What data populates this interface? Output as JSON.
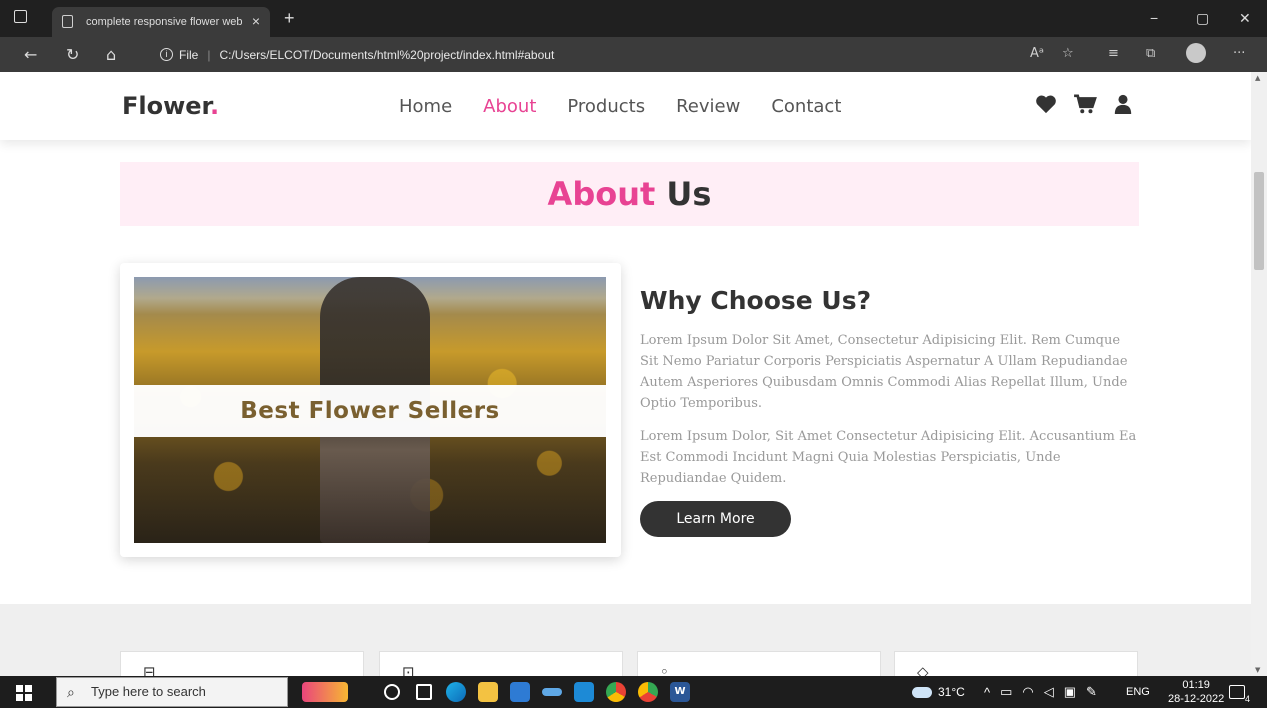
{
  "browser": {
    "tab_title": "complete responsive flower web",
    "tab_close": "×",
    "new_tab": "+",
    "protocol_label": "File",
    "url": "C:/Users/ELCOT/Documents/html%20project/index.html#about",
    "window_controls": [
      "−",
      "▢",
      "✕"
    ],
    "more": "···"
  },
  "site": {
    "logo_text": "Flower",
    "logo_dot": ".",
    "nav": [
      {
        "label": "Home",
        "active": false
      },
      {
        "label": "About",
        "active": true
      },
      {
        "label": "Products",
        "active": false
      },
      {
        "label": "Review",
        "active": false
      },
      {
        "label": "Contact",
        "active": false
      }
    ],
    "header_icons": [
      "heart-icon",
      "cart-icon",
      "user-icon"
    ],
    "accent": "#e84393"
  },
  "about": {
    "heading_highlight": "About",
    "heading_rest": "Us",
    "image_caption": "Best Flower Sellers",
    "title": "Why Choose Us?",
    "paragraph1": "Lorem Ipsum Dolor Sit Amet, Consectetur Adipisicing Elit. Rem Cumque Sit Nemo Pariatur Corporis Perspiciatis Aspernatur A Ullam Repudiandae Autem Asperiores Quibusdam Omnis Commodi Alias Repellat Illum, Unde Optio Temporibus.",
    "paragraph2": "Lorem Ipsum Dolor, Sit Amet Consectetur Adipisicing Elit. Accusantium Ea Est Commodi Incidunt Magni Quia Molestias Perspiciatis, Unde Repudiandae Quidem.",
    "button": "Learn More"
  },
  "taskbar": {
    "search_placeholder": "Type here to search",
    "weather": "31°C",
    "language": "ENG",
    "time": "01:19",
    "date": "28-12-2022",
    "notifications": "4"
  }
}
